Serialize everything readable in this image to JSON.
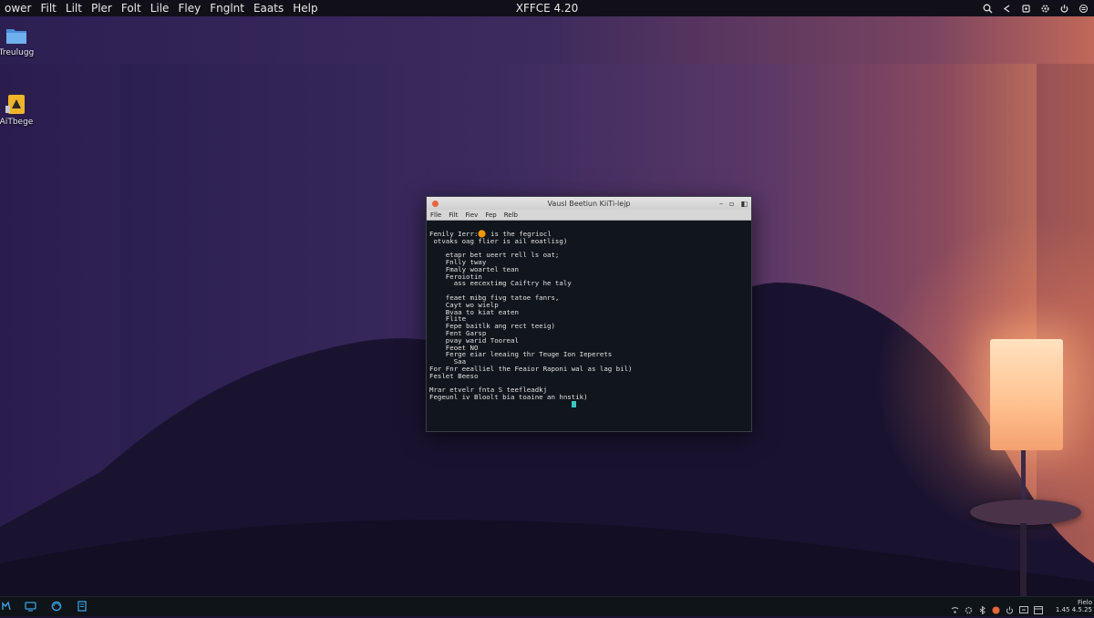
{
  "top_panel": {
    "menu": [
      "ower",
      "Filt",
      "Lilt",
      "Pler",
      "Folt",
      "Lile",
      "Fley",
      "Fnglnt",
      "Eaats",
      "Help"
    ],
    "title": "XFFCE 4.20"
  },
  "desktop_icons": [
    {
      "label": "Treulugg",
      "icon": "folder-icon"
    },
    {
      "label": "AiTbege",
      "icon": "warning-file-icon"
    }
  ],
  "terminal": {
    "title": "Vausl Beetiun KiiTi-lejp",
    "menu": [
      "Flle",
      "Filt",
      "Fiev",
      "Fep",
      "Relb"
    ],
    "lines": [
      "Fenily Ierr:🟠 is the fegriocl",
      " otvaks oag flier is ail eoatlisg)",
      "",
      "    etapr bet ueert rell ls oat;",
      "    Fnlly tway",
      "    Fmaly woartel tean",
      "    Feroiotin",
      "      ass eecextimg Caiftry he taly",
      "",
      "    feaet mibg fivg tatoe fanrs,",
      "    Cayt wo wielp",
      "    Bvaa to kiat eaten",
      "    Flite",
      "    Fepe baitlk ang rect teeig)",
      "    Fent Garsp",
      "    pvay warid Tooreal",
      "    Feoet NO",
      "    Ferge eiar leeaing thr Teuge Ion Ieperets",
      "      Saa",
      "For Fnr eealliel the Feaior Raponi wal as lag bil)",
      "Feslet Beeso",
      "",
      "Mrar etvelr fnta S teefleadkj",
      "Fegeunl iv Bloolt bia toaine an hnstik)"
    ]
  },
  "bottom_panel": {
    "launchers": [
      "terminal-launcher-icon",
      "monitor-icon",
      "browser-icon",
      "files-icon"
    ],
    "tray_icons": [
      "network-icon",
      "settings-icon",
      "bluetooth-icon",
      "record-icon",
      "power-icon",
      "display-icon",
      "window-icon"
    ],
    "clock_line1": "Fielo",
    "clock_line2": "1.45 4.5.25"
  },
  "colors": {
    "accent_orange": "#e8643c",
    "cursor": "#3cc7c0",
    "terminal_bg": "#10161c"
  }
}
